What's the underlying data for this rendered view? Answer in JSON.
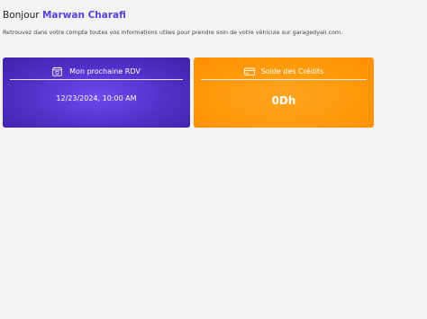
{
  "greeting": {
    "prefix": "Bonjour",
    "name": "Marwan Charafi"
  },
  "subtitle": "Retrouvez dans votre compte toutes vos informations utiles pour prendre soin de votre véhicule sur garagedyali.com.",
  "cards": {
    "rdv": {
      "icon": "calendar-icon",
      "title": "Mon prochaine RDV",
      "value": "12/23/2024, 10:00 AM",
      "color": "#5a3fd8"
    },
    "credits": {
      "icon": "wallet-icon",
      "title": "Solde des Crédits",
      "value": "0Dh",
      "color": "#ff9a0a"
    }
  }
}
